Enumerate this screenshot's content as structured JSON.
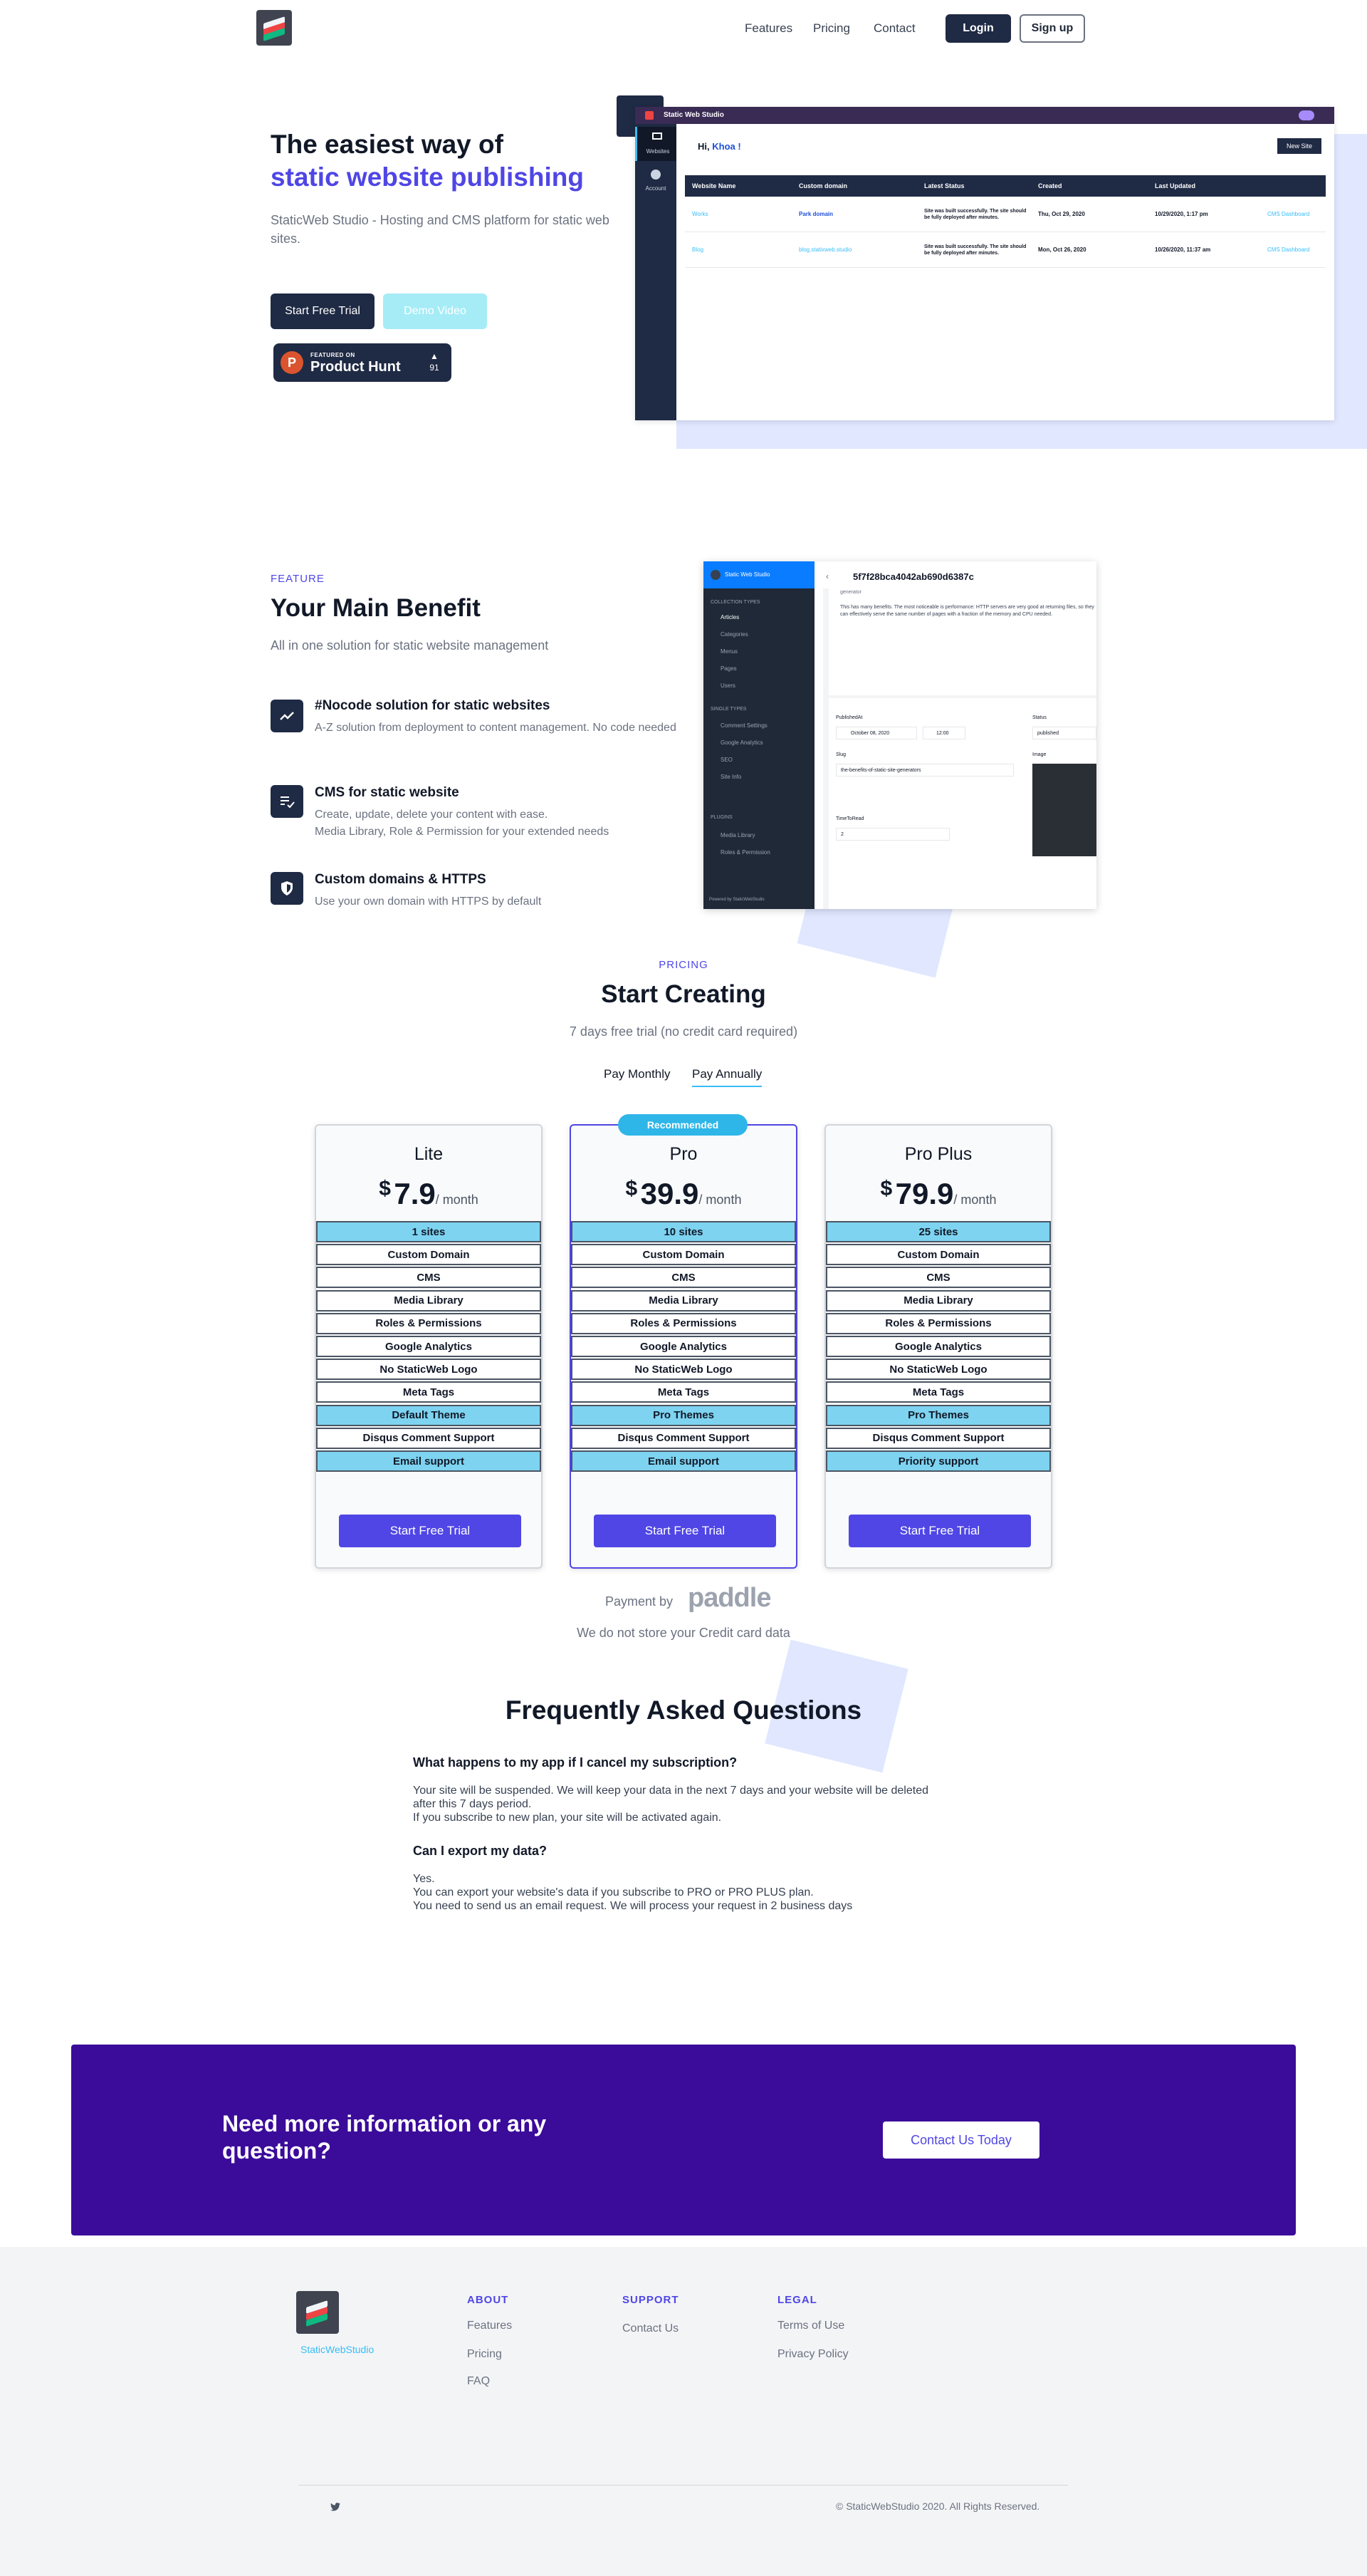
{
  "nav": {
    "links": [
      "Features",
      "Pricing",
      "Contact"
    ],
    "login": "Login",
    "signup": "Sign up"
  },
  "hero": {
    "title_line1": "The easiest way of",
    "title_line2": "static website publishing",
    "subtitle": "StaticWeb Studio - Hosting and CMS platform for static web sites.",
    "cta_primary": "Start Free Trial",
    "cta_secondary": "Demo Video",
    "product_hunt": {
      "featured": "FEATURED ON",
      "name": "Product Hunt",
      "votes": "91",
      "arrow": "▲"
    }
  },
  "dashboard": {
    "app_name": "Static Web Studio",
    "greeting": "Hi,",
    "user": "Khoa !",
    "new_site": "New Site",
    "side_items": [
      "Websites",
      "Account"
    ],
    "columns": [
      "Website Name",
      "Custom domain",
      "Latest Status",
      "Created",
      "Last Updated"
    ],
    "rows": [
      {
        "name": "Works",
        "domain": "Park domain",
        "status": "Site was built successfully. The site should be fully deployed after minutes.",
        "created": "Thu, Oct 29, 2020",
        "updated": "10/29/2020, 1:17 pm",
        "link": "CMS Dashboard"
      },
      {
        "name": "Blog",
        "domain": "blog.statixweb.studio",
        "status": "Site was built successfully. The site should be fully deployed after minutes.",
        "created": "Mon, Oct 26, 2020",
        "updated": "10/26/2020, 11:37 am",
        "link": "CMS Dashboard"
      }
    ]
  },
  "feature": {
    "eyebrow": "FEATURE",
    "title": "Your Main Benefit",
    "subtitle": "All in one solution for static website management",
    "items": [
      {
        "title": "#Nocode solution for static websites",
        "desc": "A-Z solution from deployment to content management.  No code needed"
      },
      {
        "title": "CMS for static website",
        "desc": "Create, update, delete your content with ease.\nMedia Library, Role & Permission for your extended needs"
      },
      {
        "title": "Custom domains & HTTPS",
        "desc": "Use your own domain with HTTPS by default"
      }
    ]
  },
  "cms_mock": {
    "brand": "Static Web Studio",
    "doc_id": "5f7f28bca4042ab690d6387c",
    "collection_types": "COLLECTION TYPES",
    "collection_items": [
      "Articles",
      "Categories",
      "Menus",
      "Pages",
      "Users"
    ],
    "single_types": "SINGLE TYPES",
    "single_items": [
      "Comment Settings",
      "Google Analytics",
      "SEO",
      "Site Info"
    ],
    "plugins": "PLUGINS",
    "plugin_items": [
      "Media Library",
      "Roles & Permission"
    ],
    "powered": "Powered by StaticWebStudio",
    "body_text": "This has many benefits. The most noticeable is performance: HTTP servers are very good at returning files, so they can effectively serve the same number of pages with a fraction of the memory and CPU needed.",
    "published_label": "PublishedAt",
    "published_date": "October 08, 2020",
    "published_time": "12:00",
    "status_label": "Status",
    "status_value": "published",
    "slug_label": "Slug",
    "slug_value": "the-benefits-of-static-site-generators",
    "image_label": "Image",
    "time_label": "TimeToRead",
    "time_value": "2",
    "heading_fragment": "generator"
  },
  "pricing": {
    "eyebrow": "PRICING",
    "title": "Start Creating",
    "subtitle": "7 days free trial (no credit card required)",
    "toggle_monthly": "Pay Monthly",
    "toggle_annually": "Pay Annually",
    "recommended": "Recommended",
    "plans": [
      {
        "name": "Lite",
        "currency": "$",
        "price": "7.9",
        "period": "/ month",
        "features": [
          "1 sites",
          "Custom Domain",
          "CMS",
          "Media Library",
          "Roles & Permissions",
          "Google Analytics",
          "No StaticWeb Logo",
          "Meta Tags",
          "Default Theme",
          "Disqus Comment  Support",
          "Email support"
        ],
        "cta": "Start Free Trial"
      },
      {
        "name": "Pro",
        "currency": "$",
        "price": "39.9",
        "period": "/ month",
        "features": [
          "10 sites",
          "Custom Domain",
          "CMS",
          "Media Library",
          "Roles & Permissions",
          "Google Analytics",
          "No StaticWeb Logo",
          "Meta Tags",
          "Pro Themes",
          "Disqus Comment  Support",
          "Email support"
        ],
        "cta": "Start Free Trial"
      },
      {
        "name": "Pro Plus",
        "currency": "$",
        "price": "79.9",
        "period": "/ month",
        "features": [
          "25 sites",
          "Custom Domain",
          "CMS",
          "Media Library",
          "Roles & Permissions",
          "Google Analytics",
          "No StaticWeb Logo",
          "Meta Tags",
          "Pro Themes",
          "Disqus Comment  Support",
          "Priority support"
        ],
        "cta": "Start Free Trial"
      }
    ],
    "highlight_rows": [
      0,
      8,
      10
    ],
    "payment_by": "Payment by",
    "paddle": "paddle",
    "no_store": "We do not store your Credit card data"
  },
  "faq": {
    "title": "Frequently Asked Questions",
    "items": [
      {
        "q": "What happens to my app if I cancel my subscription?",
        "a": "Your site will be suspended. We will keep your data in the next 7 days and your website will be deleted after this 7 days period.\nIf you subscribe to new plan, your site will be activated again."
      },
      {
        "q": "Can I export my data?",
        "a": "Yes.\nYou can export your website's data if you subscribe to PRO or PRO PLUS plan.\nYou need to send us an email request. We will process your request in 2 business days"
      }
    ]
  },
  "cta": {
    "text": "Need more information or any question?",
    "button": "Contact Us Today"
  },
  "footer": {
    "brand": "StaticWebStudio",
    "about_h": "ABOUT",
    "about_links": [
      "Features",
      "Pricing",
      "FAQ"
    ],
    "support_h": "SUPPORT",
    "support_links": [
      "Contact Us"
    ],
    "legal_h": "LEGAL",
    "legal_links": [
      "Terms of Use",
      "Privacy Policy"
    ],
    "copyright": "© StaticWebStudio 2020. All Rights Reserved."
  },
  "colors": {
    "accent": "#4f46e5",
    "dark": "#1f2a44",
    "cyan": "#7dd3f0",
    "cta_bg": "#3b0b9a"
  }
}
